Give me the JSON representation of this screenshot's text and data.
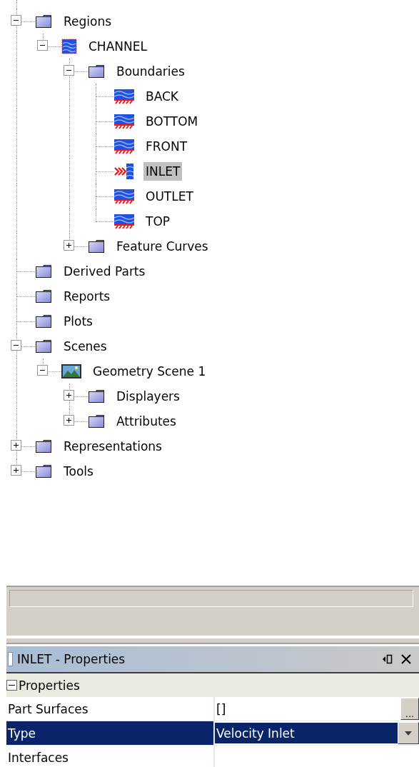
{
  "tree": [
    {
      "label": "Regions",
      "kind": "folder",
      "expanded": true,
      "selected": false,
      "children": [
        {
          "label": "CHANNEL",
          "kind": "region",
          "expanded": true,
          "selected": false,
          "children": [
            {
              "label": "Boundaries",
              "kind": "folder",
              "expanded": true,
              "selected": false,
              "children": [
                {
                  "label": "BACK",
                  "kind": "wall",
                  "selected": false
                },
                {
                  "label": "BOTTOM",
                  "kind": "wall",
                  "selected": false
                },
                {
                  "label": "FRONT",
                  "kind": "wall",
                  "selected": false
                },
                {
                  "label": "INLET",
                  "kind": "inlet",
                  "selected": true
                },
                {
                  "label": "OUTLET",
                  "kind": "wall",
                  "selected": false
                },
                {
                  "label": "TOP",
                  "kind": "wall",
                  "selected": false
                }
              ]
            },
            {
              "label": "Feature Curves",
              "kind": "folder",
              "expanded": false,
              "selected": false
            }
          ]
        }
      ]
    },
    {
      "label": "Derived Parts",
      "kind": "folder",
      "selected": false
    },
    {
      "label": "Reports",
      "kind": "folder",
      "selected": false
    },
    {
      "label": "Plots",
      "kind": "folder",
      "selected": false
    },
    {
      "label": "Scenes",
      "kind": "folder",
      "expanded": true,
      "selected": false,
      "children": [
        {
          "label": "Geometry Scene 1",
          "kind": "scene",
          "expanded": true,
          "selected": false,
          "children": [
            {
              "label": "Displayers",
              "kind": "folder",
              "expanded": false,
              "selected": false
            },
            {
              "label": "Attributes",
              "kind": "folder",
              "expanded": false,
              "selected": false
            }
          ]
        }
      ]
    },
    {
      "label": "Representations",
      "kind": "folder",
      "expanded": false,
      "selected": false
    },
    {
      "label": "Tools",
      "kind": "folder",
      "expanded": false,
      "selected": false
    }
  ],
  "properties_panel": {
    "title": "INLET - Properties",
    "category": {
      "label": "Properties",
      "expanded": true
    },
    "rows": [
      {
        "name": "Part Surfaces",
        "value": "[]",
        "kind": "button",
        "button_label": "...",
        "selected": false
      },
      {
        "name": "Type",
        "value": "Velocity Inlet",
        "kind": "dropdown",
        "selected": true
      },
      {
        "name": "Interfaces",
        "kind": "text",
        "selected": false
      }
    ]
  }
}
